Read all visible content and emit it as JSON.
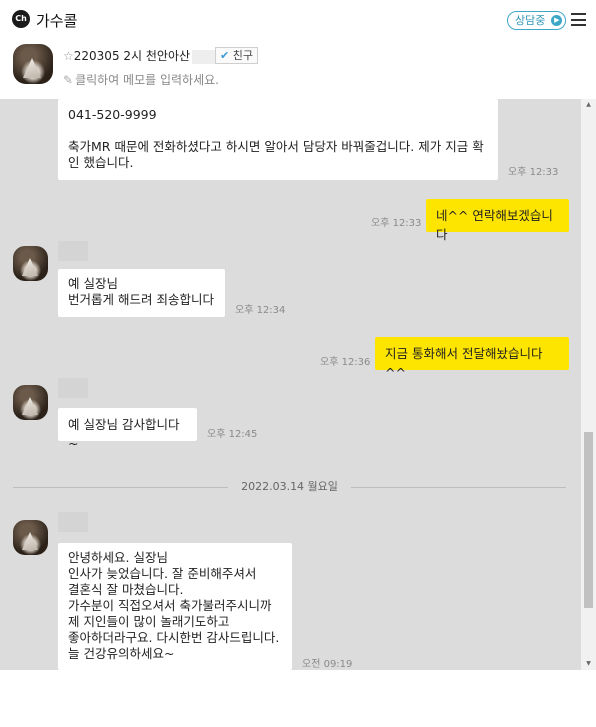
{
  "app": {
    "logo_text": "Ch",
    "title": "가수콜"
  },
  "header": {
    "status_label": "상담중",
    "status_arrow": "▶"
  },
  "profile": {
    "star": "☆",
    "name": "220305 2시 천안아산",
    "friend_label": "친구",
    "friend_check": "✔",
    "memo_placeholder": "클릭하여 메모를 입력하세요."
  },
  "messages": [
    {
      "direction": "in",
      "text": "041-520-9999\n\n축가MR 때문에 전화하셨다고 하시면 알아서 담당자 바꿔줄겁니다. 제가 지금 확인 했습니다.",
      "time": "오후 12:33"
    },
    {
      "direction": "out",
      "text": "네^^ 연락해보겠습니다",
      "time": "오후 12:33"
    },
    {
      "direction": "in",
      "text": "예 실장님\n번거롭게 해드려 죄송합니다",
      "time": "오후 12:34"
    },
    {
      "direction": "out",
      "text": "지금 통화해서 전달해놨습니다^^",
      "time": "오후 12:36"
    },
    {
      "direction": "in",
      "text": "예 실장님 감사합니다~",
      "time": "오후 12:45"
    },
    {
      "direction": "in",
      "text": "안녕하세요. 실장님\n인사가 늦었습니다. 잘 준비해주셔서\n결혼식 잘 마쳤습니다.\n가수분이 직접오셔서 축가불러주시니까\n제 지인들이 많이 놀래기도하고\n좋아하더라구요. 다시한번 감사드립니다.\n늘 건강유의하세요~",
      "time": "오전 09:19"
    }
  ],
  "date_divider": "2022.03.14 월요일",
  "colors": {
    "chat_bg": "#dcdcdc",
    "out_bubble": "#fee500",
    "in_bubble": "#ffffff",
    "status_accent": "#3ea6c7"
  }
}
